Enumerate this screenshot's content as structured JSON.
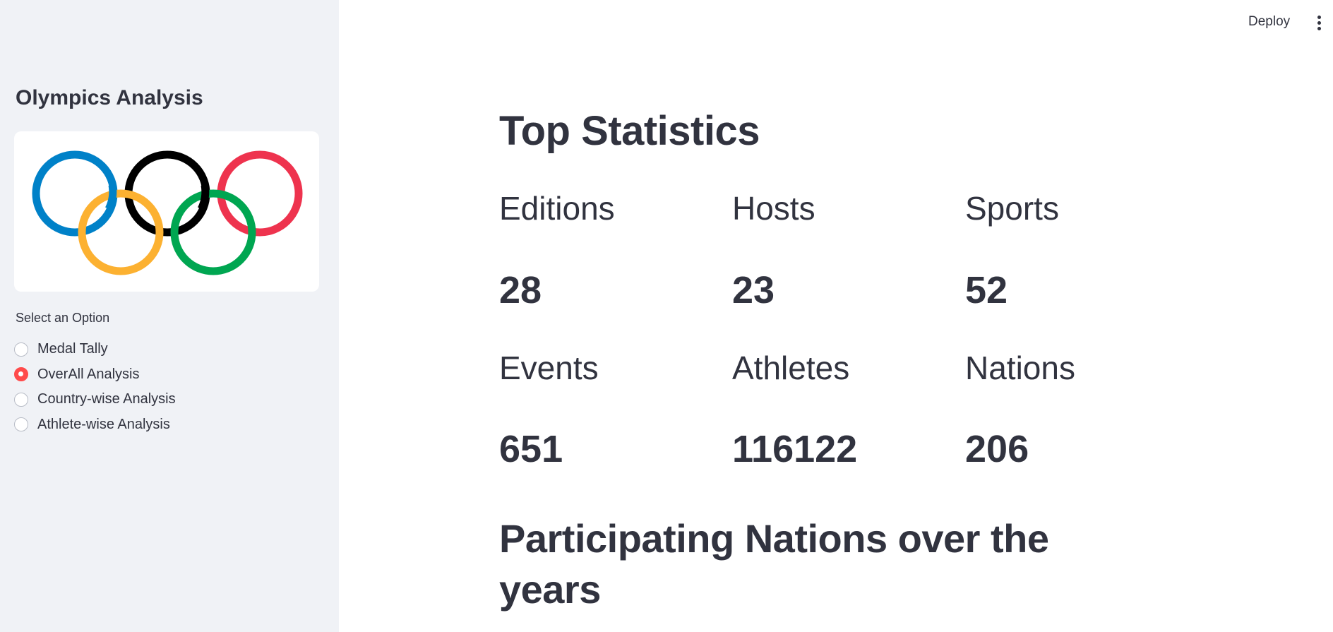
{
  "header": {
    "deploy_label": "Deploy",
    "menu_icon": "kebab-vertical-icon"
  },
  "sidebar": {
    "title": "Olympics Analysis",
    "logo": "olympic-rings",
    "radio_label": "Select an Option",
    "options": [
      {
        "label": "Medal Tally",
        "selected": false
      },
      {
        "label": "OverAll Analysis",
        "selected": true
      },
      {
        "label": "Country-wise Analysis",
        "selected": false
      },
      {
        "label": "Athlete-wise Analysis",
        "selected": false
      }
    ]
  },
  "main": {
    "title": "Top Statistics",
    "stats": [
      {
        "label": "Editions",
        "value": "28"
      },
      {
        "label": "Hosts",
        "value": "23"
      },
      {
        "label": "Sports",
        "value": "52"
      },
      {
        "label": "Events",
        "value": "651"
      },
      {
        "label": "Athletes",
        "value": "116122"
      },
      {
        "label": "Nations",
        "value": "206"
      }
    ],
    "section_title": "Participating Nations over the years"
  },
  "colors": {
    "sidebar_bg": "#f0f2f6",
    "accent": "#ff4b4b",
    "text": "#31333f",
    "ring_blue": "#0081c8",
    "ring_black": "#000000",
    "ring_red": "#ee334e",
    "ring_yellow": "#fcb131",
    "ring_green": "#00a651"
  }
}
